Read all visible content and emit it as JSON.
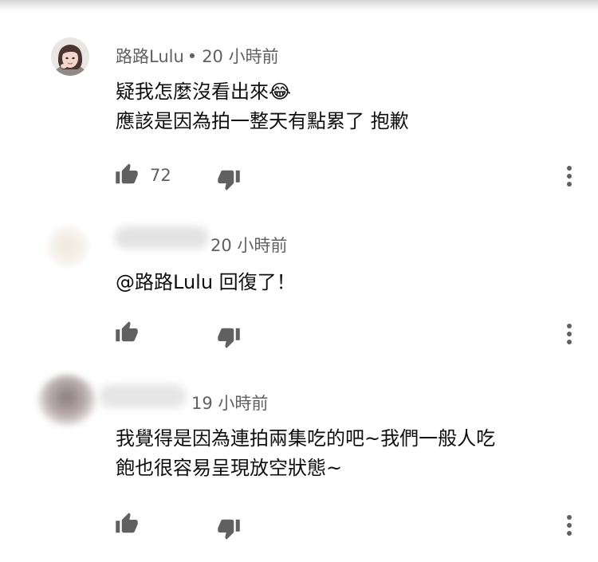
{
  "comments": [
    {
      "author": "路路Lulu",
      "separator": "•",
      "time": "20 小時前",
      "lines": [
        "疑我怎麼沒看出來😂",
        "應該是因為拍一整天有點累了 抱歉"
      ],
      "likes": "72",
      "icons": {
        "like": "thumbs-up-icon",
        "dislike": "thumbs-down-icon",
        "more": "more-vert-icon"
      }
    },
    {
      "author": "",
      "time": "20 小時前",
      "lines": [
        "@路路Lulu 回復了！"
      ],
      "likes": "",
      "icons": {
        "like": "thumbs-up-icon",
        "dislike": "thumbs-down-icon",
        "more": "more-vert-icon"
      }
    },
    {
      "author": "",
      "time": "19 小時前",
      "lines": [
        "我覺得是因為連拍兩集吃的吧~我們一般人吃",
        "飽也很容易呈現放空狀態~"
      ],
      "likes": "",
      "icons": {
        "like": "thumbs-up-icon",
        "dislike": "thumbs-down-icon",
        "more": "more-vert-icon"
      }
    }
  ],
  "colors": {
    "text": "#0f0f0f",
    "meta": "#606060",
    "icon": "#606060"
  }
}
